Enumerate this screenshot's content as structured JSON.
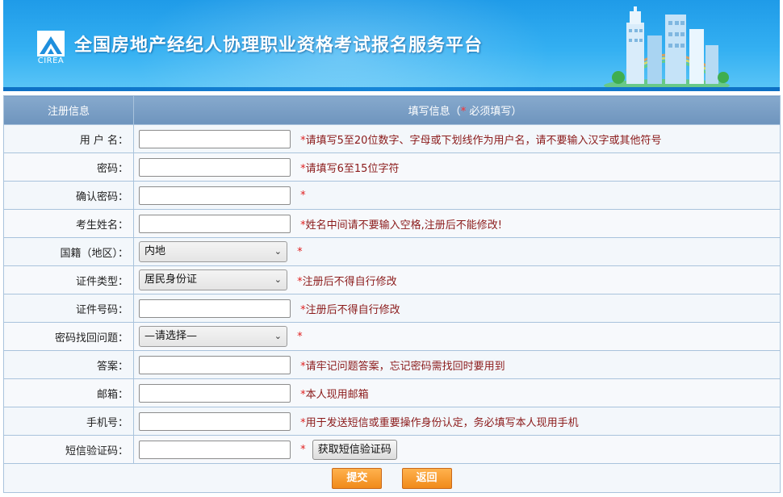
{
  "header": {
    "logo_text": "CIREA",
    "title": "全国房地产经纪人协理职业资格考试报名服务平台"
  },
  "table_head": {
    "left": "注册信息",
    "right_prefix": "填写信息（",
    "right_star": "*",
    "right_suffix": "  必须填写）"
  },
  "fields": {
    "username": {
      "label": "用 户 名：",
      "value": "",
      "hint_star": "*",
      "hint": "请填写5至20位数字、字母或下划线作为用户名，请不要输入汉字或其他符号"
    },
    "password": {
      "label": "密码：",
      "value": "",
      "hint_star": "*",
      "hint": "请填写6至15位字符"
    },
    "confirm_password": {
      "label": "确认密码：",
      "value": "",
      "hint_star": "*",
      "hint": ""
    },
    "name": {
      "label": "考生姓名：",
      "value": "",
      "hint_star": "*",
      "hint": "姓名中间请不要输入空格,注册后不能修改!"
    },
    "nationality": {
      "label": "国籍（地区）：",
      "selected": "内地",
      "hint_star": "*",
      "hint": ""
    },
    "id_type": {
      "label": "证件类型：",
      "selected": "居民身份证",
      "hint_star": "*",
      "hint": "注册后不得自行修改"
    },
    "id_number": {
      "label": "证件号码：",
      "value": "",
      "hint_star": "*",
      "hint": "注册后不得自行修改"
    },
    "security_question": {
      "label": "密码找回问题：",
      "selected": "—请选择—",
      "hint_star": "*",
      "hint": ""
    },
    "answer": {
      "label": "答案：",
      "value": "",
      "hint_star": "*",
      "hint": "请牢记问题答案，忘记密码需找回时要用到"
    },
    "email": {
      "label": "邮箱：",
      "value": "",
      "hint_star": "*",
      "hint": "本人现用邮箱"
    },
    "mobile": {
      "label": "手机号：",
      "value": "",
      "hint_star": "*",
      "hint": "用于发送短信或重要操作身份认定，务必填写本人现用手机"
    },
    "sms_code": {
      "label": "短信验证码：",
      "value": "",
      "hint_star": "*",
      "button": "获取短信验证码"
    }
  },
  "actions": {
    "submit": "提交",
    "back": "返回"
  },
  "colors": {
    "banner": "#2aa6ee",
    "table_header": "#7a9ec6",
    "hint_text": "#8b1a1a",
    "required_star": "#e02020",
    "action_button": "#f39a2a"
  },
  "icons": {
    "logo": "cirea-logo-icon",
    "skyline": "city-skyline-icon",
    "dropdown": "chevron-down-icon"
  }
}
